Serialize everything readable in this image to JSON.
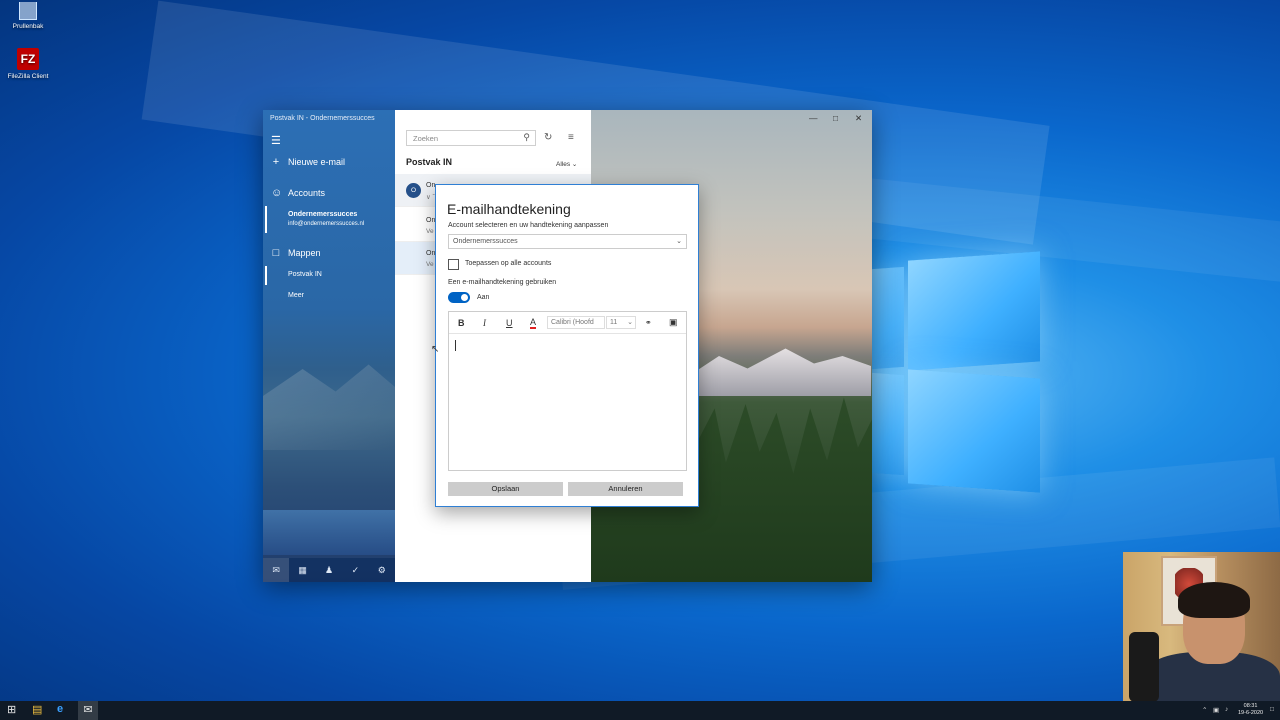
{
  "desktop": {
    "icons": [
      {
        "label": "Prullenbak",
        "icon": "recycle-bin-icon"
      },
      {
        "label": "FileZilla Client",
        "icon": "filezilla-icon"
      }
    ]
  },
  "mail": {
    "window_title": "Postvak IN - Ondernemerssucces",
    "nav": {
      "new_mail": "Nieuwe e-mail",
      "accounts": "Accounts",
      "account_name": "Ondernemerssucces",
      "account_email": "info@ondernemerssucces.nl",
      "folders": "Mappen",
      "folder_inbox": "Postvak IN",
      "folder_more": "Meer"
    },
    "search_placeholder": "Zoeken",
    "inbox_title": "Postvak IN",
    "filter_label": "Alles",
    "messages": [
      {
        "avatar": "O",
        "line1": "On",
        "line2": "∨ ˇ"
      },
      {
        "line1": "On",
        "line2": "Ve"
      },
      {
        "line1": "On",
        "line2": "Ve"
      }
    ]
  },
  "dialog": {
    "title": "E-mailhandtekening",
    "subtitle": "Account selecteren en uw handtekening aanpassen",
    "account_value": "Ondernemerssucces",
    "apply_all_label": "Toepassen op alle accounts",
    "apply_all_checked": false,
    "use_signature_label": "Een e-mailhandtekening gebruiken",
    "toggle_label": "Aan",
    "toggle_on": true,
    "toolbar": {
      "bold": "B",
      "italic": "I",
      "underline": "U",
      "font_color": "A",
      "font_value": "Calibri (Hoofd",
      "size_value": "11"
    },
    "save_label": "Opslaan",
    "cancel_label": "Annuleren"
  },
  "taskbar": {
    "time": "08:31",
    "date": "19-6-2020"
  },
  "colors": {
    "accent": "#0063c4",
    "taskbar": "#101a26",
    "dialog_border": "#2f7fd4"
  }
}
